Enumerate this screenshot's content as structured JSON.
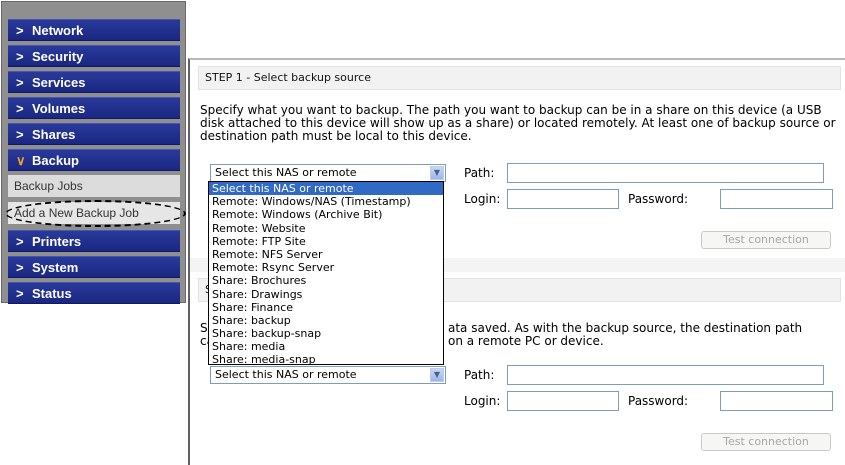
{
  "sidebar": {
    "items": [
      {
        "label": "Network"
      },
      {
        "label": "Security"
      },
      {
        "label": "Services"
      },
      {
        "label": "Volumes"
      },
      {
        "label": "Shares"
      },
      {
        "label": "Backup"
      },
      {
        "label": "Printers"
      },
      {
        "label": "System"
      },
      {
        "label": "Status"
      }
    ],
    "backup_sub": {
      "jobs": "Backup Jobs",
      "add_new": "Add a New Backup Job"
    }
  },
  "step1": {
    "header": "STEP 1 - Select backup source",
    "description": "Specify what you want to backup. The path you want to backup can be in a share on this device (a USB disk attached to this device will show up as a share) or located remotely. At least one of backup source or destination path must be local to this device.",
    "select_value": "Select this NAS or remote",
    "path_label": "Path:",
    "login_label": "Login:",
    "password_label": "Password:",
    "test_button": "Test connection"
  },
  "step2": {
    "header_fragment": "S",
    "description_line1_a": "S",
    "description_line1_b": "ata saved. As with the backup source, the destination path",
    "description_line2_a": "ca",
    "description_line2_b": "on a remote PC or device.",
    "select_value": "Select this NAS or remote",
    "path_label": "Path:",
    "login_label": "Login:",
    "password_label": "Password:",
    "test_button": "Test connection"
  },
  "dropdown": {
    "options": [
      "Select this NAS or remote",
      "Remote: Windows/NAS (Timestamp)",
      "Remote: Windows (Archive Bit)",
      "Remote: Website",
      "Remote: FTP Site",
      "Remote: NFS Server",
      "Remote: Rsync Server",
      "Share: Brochures",
      "Share: Drawings",
      "Share: Finance",
      "Share: backup",
      "Share: backup-snap",
      "Share: media",
      "Share: media-snap"
    ],
    "selected_index": 0
  },
  "colors": {
    "nav_bg": "#1f2c8a",
    "selected_option": "#316ac5",
    "backup_chevron": "#f0a030"
  },
  "icons": {
    "nav_chevron": "chevron-right-icon",
    "open_chevron": "chevron-down-icon",
    "select_arrow": "dropdown-arrow-icon"
  }
}
